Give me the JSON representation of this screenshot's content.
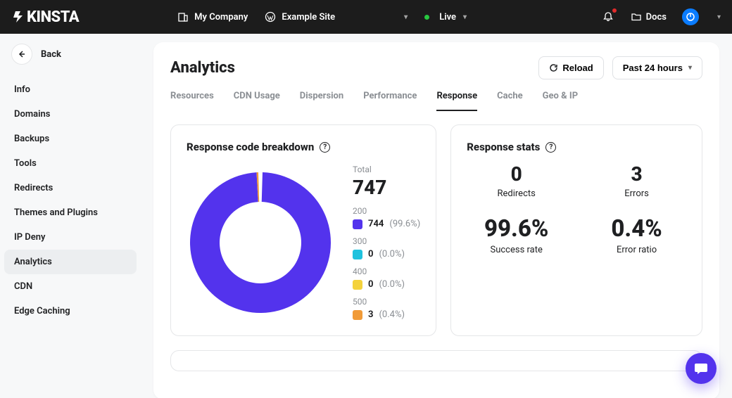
{
  "top": {
    "company": "My Company",
    "site": "Example Site",
    "env": "Live",
    "docs": "Docs"
  },
  "back_label": "Back",
  "sidebar": {
    "items": [
      {
        "label": "Info"
      },
      {
        "label": "Domains"
      },
      {
        "label": "Backups"
      },
      {
        "label": "Tools"
      },
      {
        "label": "Redirects"
      },
      {
        "label": "Themes and Plugins"
      },
      {
        "label": "IP Deny"
      },
      {
        "label": "Analytics",
        "active": true
      },
      {
        "label": "CDN"
      },
      {
        "label": "Edge Caching"
      }
    ]
  },
  "page": {
    "title": "Analytics",
    "reload": "Reload",
    "range": "Past 24 hours"
  },
  "tabs": [
    {
      "label": "Resources"
    },
    {
      "label": "CDN Usage"
    },
    {
      "label": "Dispersion"
    },
    {
      "label": "Performance"
    },
    {
      "label": "Response",
      "active": true
    },
    {
      "label": "Cache"
    },
    {
      "label": "Geo & IP"
    }
  ],
  "breakdown": {
    "title": "Response code breakdown",
    "total_label": "Total",
    "total": "747",
    "legend": [
      {
        "code": "200",
        "value": "744",
        "pct": "(99.6%)",
        "color": "#5333ed"
      },
      {
        "code": "300",
        "value": "0",
        "pct": "(0.0%)",
        "color": "#1fc2de"
      },
      {
        "code": "400",
        "value": "0",
        "pct": "(0.0%)",
        "color": "#f4d23c"
      },
      {
        "code": "500",
        "value": "3",
        "pct": "(0.4%)",
        "color": "#f19b38"
      }
    ]
  },
  "stats": {
    "title": "Response stats",
    "redirects_v": "0",
    "redirects_l": "Redirects",
    "errors_v": "3",
    "errors_l": "Errors",
    "success_v": "99.6%",
    "success_l": "Success rate",
    "ratio_v": "0.4%",
    "ratio_l": "Error ratio"
  },
  "chart_data": {
    "type": "pie",
    "title": "Response code breakdown",
    "categories": [
      "200",
      "300",
      "400",
      "500"
    ],
    "values": [
      744,
      0,
      0,
      3
    ],
    "colors": [
      "#5333ed",
      "#1fc2de",
      "#f4d23c",
      "#f19b38"
    ],
    "total": 747,
    "donut": true
  }
}
